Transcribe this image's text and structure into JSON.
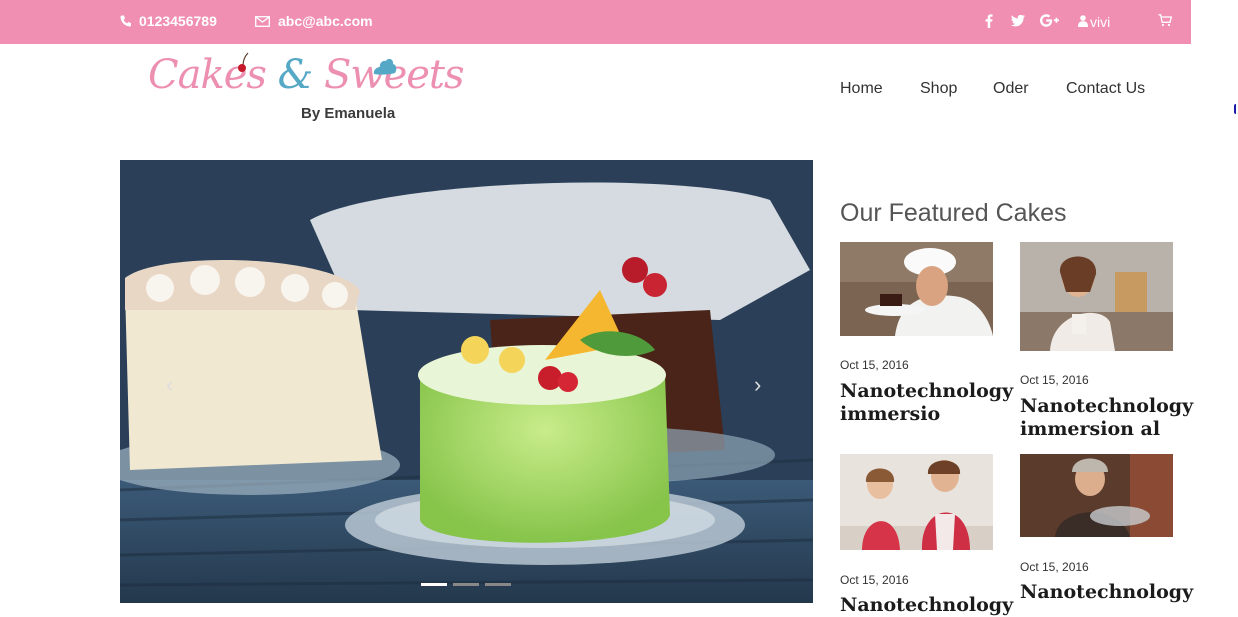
{
  "topbar": {
    "phone": "0123456789",
    "email": "abc@abc.com",
    "social_icons": [
      "facebook-icon",
      "twitter-icon",
      "google-plus-icon"
    ],
    "user": "vivi",
    "bg_color": "#f08fb1"
  },
  "logo": {
    "word1": "Cakes",
    "amp": "&",
    "word2": "Sweets",
    "by": "By Emanuela"
  },
  "nav": {
    "home": "Home",
    "shop": "Shop",
    "oder": "Oder",
    "contact": "Contact Us"
  },
  "slider": {
    "prev": "‹",
    "next": "›",
    "slides_count": 3,
    "active_slide": 1
  },
  "featured": {
    "title": "Our Featured Cakes",
    "cards": [
      {
        "date": "Oct 15, 2016",
        "title": "Nanotechnology immersio"
      },
      {
        "date": "Oct 15, 2016",
        "title": "Nanotechnology immersion al"
      },
      {
        "date": "Oct 15, 2016",
        "title": "Nanotechnology"
      },
      {
        "date": "Oct 15, 2016",
        "title": "Nanotechnology"
      }
    ]
  }
}
